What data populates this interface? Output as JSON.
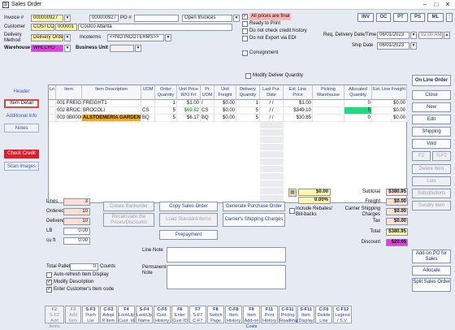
{
  "window": {
    "title": "Sales Order",
    "minimize": "–",
    "maximize": "□",
    "close": "✕"
  },
  "header": {
    "invoice_label": "Invoice #",
    "invoice_value": "000000927",
    "po_prefix": "000000927",
    "po_label": "PO #",
    "status_value": "Open Invoices",
    "customer_label": "Customer",
    "customer_code": "COSTCO",
    "customer_num": "000001",
    "customer_name": "Costco Atlanta",
    "delivery_label": "Delivery Method",
    "delivery_value": "Delivery Order",
    "incoterms_label": "Incoterms",
    "incoterms_value": "<<NO INCOTERMS>>",
    "warehouse_label": "Warehouse",
    "warehouse_value": "WHLCRO",
    "business_unit_label": "Business Unit",
    "checks": [
      {
        "label": "All prices are final",
        "checked": true
      },
      {
        "label": "Ready to Print",
        "checked": false
      },
      {
        "label": "Do not check credit history",
        "checked": false
      },
      {
        "label": "Do not Export via EDI",
        "checked": false
      }
    ],
    "consignment_label": "Consignment",
    "req_date_label": "Req. Delivery Date/Time",
    "req_date_value": "06/01/2023",
    "req_time_value": "02:00 AM",
    "ship_date_label": "Ship Date",
    "ship_date_value": "06/01/2023",
    "top_buttons": [
      "INV",
      "OC",
      "PT",
      "PS",
      "ML"
    ]
  },
  "modify_deliver_label": "Modify Deliver Quantity",
  "left_tabs": [
    "Header",
    "Item Detail",
    "Additional Info",
    "Notes",
    "Check Credit",
    "Scan Images"
  ],
  "grid": {
    "columns": [
      "Ln",
      "Item",
      "Item Description",
      "UOM",
      "Order Quantity",
      "Unit Price W/O Frt",
      "Pr UOM",
      "Unit Freight",
      "Delivery Quantity",
      "Last Pur. Date",
      "Ext. Line Price",
      "Picking Warehouse",
      "Allocated Quantity",
      "Ext. Line Freight"
    ],
    "rows": [
      {
        "ln": "001",
        "item": "FREIGHT1",
        "desc": "FREIGHT1",
        "uom": "",
        "qty": "1",
        "price": "$1.00",
        "pruom": "/",
        "freight": "$0.00",
        "dqty": "1",
        "last": "/ /",
        "ext": "$1.00",
        "pick": "",
        "alloc": "0",
        "extf": "$0.00"
      },
      {
        "ln": "002",
        "item": "BROC1",
        "desc": "BROCOLI",
        "uom": "CS",
        "qty": "5",
        "price": "$69.82",
        "pruom": "CS",
        "freight": "$0.00",
        "dqty": "5",
        "last": "/ /",
        "ext": "$349.10",
        "pick": "",
        "alloc": "5",
        "extf": "$0.00"
      },
      {
        "ln": "003",
        "item": "0B000022",
        "desc": "ALSTOEMERIA GARDEN",
        "uom": "BQ",
        "qty": "5",
        "price": "$6.17",
        "pruom": "BQ",
        "freight": "$0.00",
        "dqty": "5",
        "last": "/ /",
        "ext": "$30.85",
        "pick": "",
        "alloc": "0",
        "extf": "$0.00"
      }
    ]
  },
  "right_buttons": [
    "On Line Order",
    "Close",
    "New",
    "Edit",
    "Shipping",
    "Void",
    "F2",
    "S-F2",
    "Delete Item",
    "Lots",
    "Substitutions",
    "Sundry Item",
    "Add-on PO for Sales",
    "Allocate",
    "Split Sales Order"
  ],
  "stats": [
    {
      "label": "Lines",
      "value": "3"
    },
    {
      "label": "Ordered",
      "value": "10"
    },
    {
      "label": "Delivered",
      "value": "10"
    },
    {
      "label": "LB",
      "value": "0.00"
    },
    {
      "label": "cu ft",
      "value": "0.00"
    }
  ],
  "mid_buttons": {
    "create_backorder": "Create Backorder",
    "copy_sales_order": "Copy Sales Order",
    "generate_po": "Generate Purchase Order",
    "recalculate": "Recalculate the Prices/Discounts",
    "load_standard": "Load Standard Items",
    "carrier_charges": "Carrier's Shipping Charges",
    "prepayment": "Prepayment"
  },
  "rebate": {
    "amount": "$0.00",
    "percent": "0.00%",
    "label": "Include Rebates/ Bill-backs"
  },
  "totals": [
    {
      "label": "Subtotal",
      "value": "$380.95",
      "color": "#fde0d3"
    },
    {
      "label": "Freight",
      "value": "$0.00",
      "color": "#fde0d3"
    },
    {
      "label": "Carrier Shipping Charges",
      "value": "$0.00",
      "color": "#fde0d3"
    },
    {
      "label": "Tax",
      "value": "$0.00",
      "color": "#fde0d3"
    },
    {
      "label": "Total",
      "value": "$380.95",
      "color": "#fff8a6"
    },
    {
      "label": "Discount",
      "value": "$20.05",
      "color": "#e83ae3"
    }
  ],
  "total_pallet_label": "Total Pallet",
  "total_pallet_value": "0",
  "counts_label": "Counts",
  "bottom_checks": [
    {
      "label": "Auto-refresh Item Display",
      "checked": false
    },
    {
      "label": "Modify Description",
      "checked": true
    },
    {
      "label": "Enter Customer's Item code",
      "checked": true
    }
  ],
  "line_note_label": "Line Note",
  "permanent_note_label": "Permanent Note",
  "fkeys": [
    {
      "key": "F2",
      "label": "S-F2 Add Items",
      "disabled": true
    },
    {
      "key": "F3",
      "label": "Add Item",
      "disabled": true
    },
    {
      "key": "S-F3",
      "label": "Push List",
      "disabled": false
    },
    {
      "key": "C-F3",
      "label": "Adopt P.Item",
      "disabled": false
    },
    {
      "key": "F4",
      "label": "LookUp Cust. Id",
      "disabled": false
    },
    {
      "key": "S-F4",
      "label": "LookUp Name",
      "disabled": false
    },
    {
      "key": "C-F5",
      "label": "Cust. History",
      "disabled": false
    },
    {
      "key": "F6",
      "label": "Enter Cust ID",
      "disabled": false
    },
    {
      "key": "F7",
      "label": "S-F7 C-F7",
      "disabled": false
    },
    {
      "key": "F8",
      "label": "Switch Page",
      "disabled": false
    },
    {
      "key": "C-F8",
      "label": "Item History",
      "disabled": false
    },
    {
      "key": "F9",
      "label": "Item Add-on Costs",
      "disabled": false
    },
    {
      "key": "F11",
      "label": "Print History",
      "disabled": false
    },
    {
      "key": "C-F11",
      "label": "Pricing RoadMap",
      "disabled": false
    },
    {
      "key": "S-F11",
      "label": "Item Display",
      "disabled": false
    },
    {
      "key": "C-F6",
      "label": "Delete Line",
      "disabled": false
    },
    {
      "key": "C-F12",
      "label": "Legend / S.V.",
      "disabled": false
    }
  ]
}
